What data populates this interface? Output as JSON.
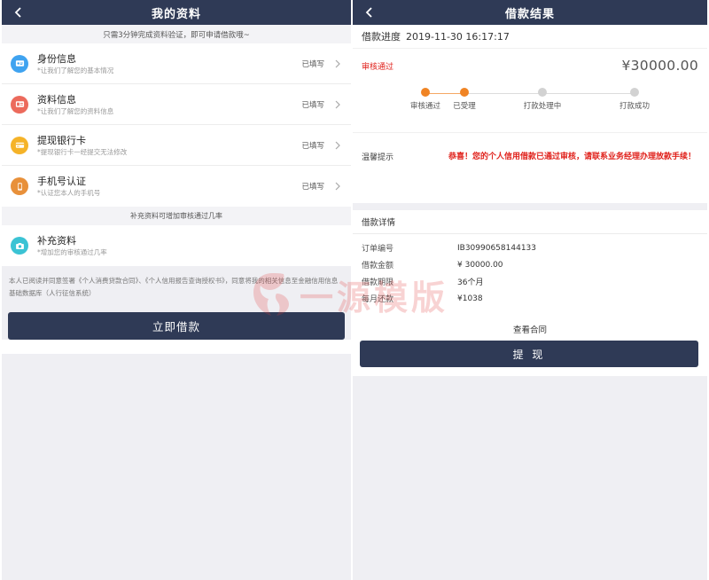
{
  "left": {
    "nav_title": "我的资料",
    "hint": "只需3分钟完成资料验证，即可申请借款哦~",
    "items": [
      {
        "title": "身份信息",
        "subtitle": "*让我们了解您的基本情况",
        "status": "已填写",
        "icon": "id-card-icon",
        "color": "#3fa3f0"
      },
      {
        "title": "资料信息",
        "subtitle": "*让我们了解您的资料信息",
        "status": "已填写",
        "icon": "profile-card-icon",
        "color": "#ec6a5c"
      },
      {
        "title": "提现银行卡",
        "subtitle": "*提现银行卡一经提交无法修改",
        "status": "已填写",
        "icon": "bank-card-icon",
        "color": "#f5b328"
      },
      {
        "title": "手机号认证",
        "subtitle": "*认证您本人的手机号",
        "status": "已填写",
        "icon": "phone-icon",
        "color": "#e8903a"
      }
    ],
    "supplement_hint": "补充资料可增加审核通过几率",
    "supplement": {
      "title": "补充资料",
      "subtitle": "*增加您的审核通过几率",
      "icon": "camera-icon",
      "color": "#3bc3d4"
    },
    "terms": "本人已阅读并同意签署《个人消费贷款合同》、《个人信用报告查询授权书》，同意将我的相关信息至金融信用信息基础数据库（人行征信系统）",
    "submit_label": "立即借款"
  },
  "right": {
    "nav_title": "借款结果",
    "progress_label": "借款进度",
    "progress_time": "2019-11-30 16:17:17",
    "status": "审核通过",
    "amount": "¥30000.00",
    "steps": [
      {
        "label": "审核通过",
        "done": true
      },
      {
        "label": "已受理",
        "done": true
      },
      {
        "label": "打款处理中",
        "done": false
      },
      {
        "label": "打款成功",
        "done": false
      }
    ],
    "warm_label": "温馨提示",
    "warm_text": "恭喜！您的个人信用借款已通过审核，请联系业务经理办理放款手续！",
    "detail_title": "借款详情",
    "details": [
      {
        "key": "订单编号",
        "value": "IB30990658144133"
      },
      {
        "key": "借款金额",
        "value": "¥ 30000.00"
      },
      {
        "key": "借款期限",
        "value": "36个月"
      },
      {
        "key": "每月还款",
        "value": "¥1038"
      }
    ],
    "contract_label": "查看合同",
    "withdraw_label": "提 现"
  },
  "watermark": {
    "text": "一源模版"
  },
  "colors": {
    "navbar": "#2f3a56",
    "accent_red": "#e0221c",
    "step_active": "#f08424"
  }
}
